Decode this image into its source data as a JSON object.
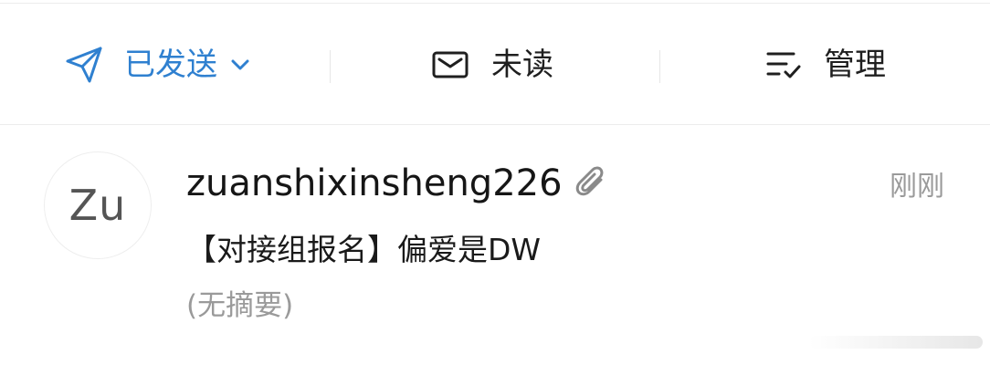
{
  "toolbar": {
    "sent_label": "已发送",
    "unread_label": "未读",
    "manage_label": "管理"
  },
  "mail": {
    "avatar_initials": "Zu",
    "sender": "zuanshixinsheng226",
    "time": "刚刚",
    "subject": "【对接组报名】偏爱是DW",
    "summary": "(无摘要)",
    "has_attachment": true
  },
  "colors": {
    "accent": "#2f80d0",
    "text": "#1a1a1a",
    "muted": "#9a9a9a",
    "divider": "#ececec"
  },
  "icons": {
    "sent": "paper-plane-icon",
    "dropdown": "chevron-down-icon",
    "unread": "envelope-icon",
    "manage": "filter-list-icon",
    "attachment": "paperclip-icon"
  }
}
